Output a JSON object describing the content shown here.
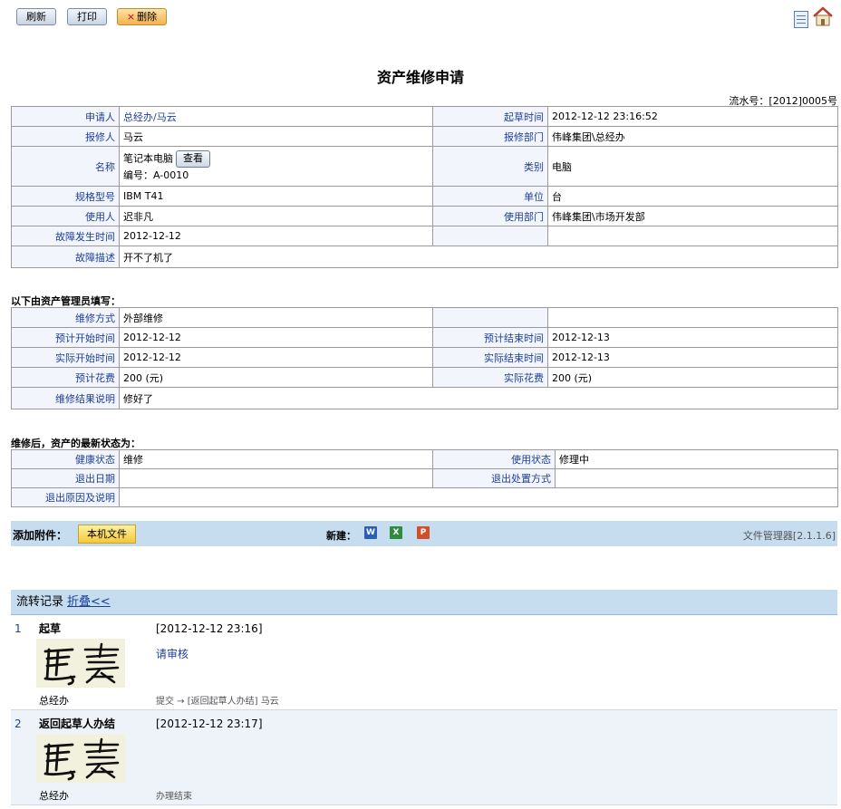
{
  "toolbar": {
    "refresh": "刷新",
    "print": "打印",
    "delete_x": "×",
    "delete": "删除"
  },
  "icons": {
    "doc": "document-icon",
    "home": "home-icon"
  },
  "title": "资产维修申请",
  "serial": "流水号：[2012]0005号",
  "form": {
    "applicant_label": "申请人",
    "applicant": "总经办/马云",
    "draft_time_label": "起草时间",
    "draft_time": "2012-12-12 23:16:52",
    "reporter_label": "报修人",
    "reporter": "马云",
    "report_dept_label": "报修部门",
    "report_dept": "伟峰集团\\总经办",
    "name_label": "名称",
    "name": "笔记本电脑",
    "view_button": "查看",
    "code": "编号：A-0010",
    "category_label": "类别",
    "category": "电脑",
    "model_label": "规格型号",
    "model": "IBM T41",
    "unit_label": "单位",
    "unit": "台",
    "user_label": "使用人",
    "user": "迟非凡",
    "use_dept_label": "使用部门",
    "use_dept": "伟峰集团\\市场开发部",
    "fault_time_label": "故障发生时间",
    "fault_time": "2012-12-12",
    "fault_desc_label": "故障描述",
    "fault_desc": "开不了机了"
  },
  "admin_section": "以下由资产管理员填写：",
  "admin": {
    "method_label": "维修方式",
    "method": "外部维修",
    "plan_start_label": "预计开始时间",
    "plan_start": "2012-12-12",
    "plan_end_label": "预计结束时间",
    "plan_end": "2012-12-13",
    "actual_start_label": "实际开始时间",
    "actual_start": "2012-12-12",
    "actual_end_label": "实际结束时间",
    "actual_end": "2012-12-13",
    "plan_cost_label": "预计花费",
    "plan_cost": "200 (元)",
    "actual_cost_label": "实际花费",
    "actual_cost": "200 (元)",
    "result_label": "维修结果说明",
    "result": "修好了"
  },
  "status_section": "维修后，资产的最新状态为：",
  "status": {
    "health_label": "健康状态",
    "health": "维修",
    "usage_label": "使用状态",
    "usage": "修理中",
    "exit_date_label": "退出日期",
    "exit_method_label": "退出处置方式",
    "exit_reason_label": "退出原因及说明"
  },
  "attach": {
    "label": "添加附件：",
    "local_button": "本机文件",
    "new_label": "新建：",
    "word": "W",
    "excel": "X",
    "ppt": "P",
    "version": "文件管理器[2.1.1.6]"
  },
  "flow": {
    "header": "流转记录",
    "fold": "折叠<<",
    "records": [
      {
        "num": "1",
        "step": "起草",
        "dept": "总经办",
        "time": "[2012-12-12 23:16]",
        "comment": "请审核",
        "action": "提交 → [返回起草人办结] 马云"
      },
      {
        "num": "2",
        "step": "返回起草人办结",
        "dept": "总经办",
        "time": "[2012-12-12 23:17]",
        "comment": "",
        "action": "办理结束"
      }
    ]
  }
}
